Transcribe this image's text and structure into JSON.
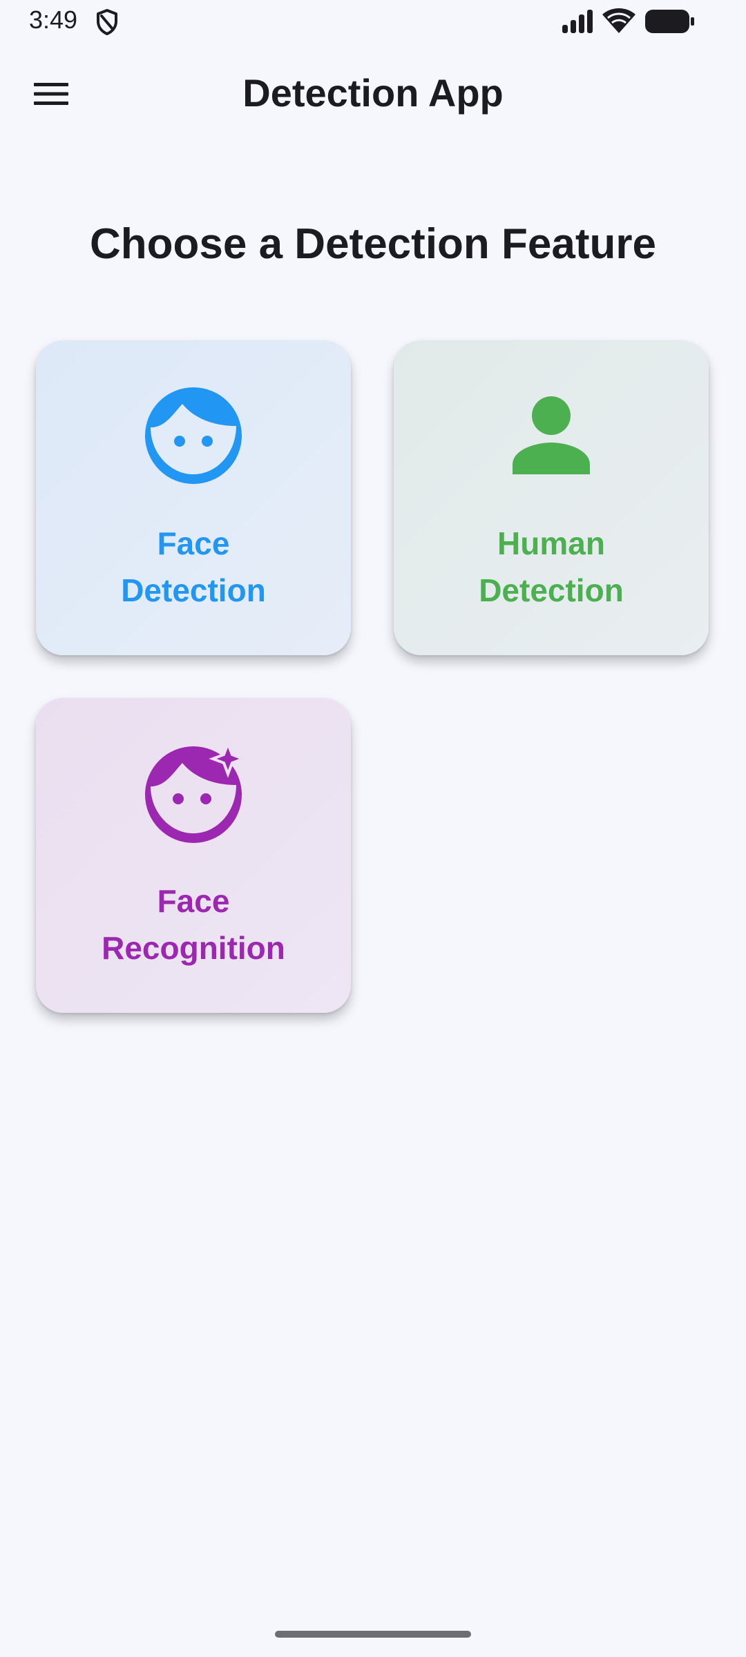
{
  "status_bar": {
    "time": "3:49",
    "icons": [
      "shield-icon",
      "signal-icon",
      "wifi-icon",
      "battery-icon"
    ]
  },
  "app_bar": {
    "title": "Detection App",
    "menu_icon": "menu-icon"
  },
  "main": {
    "heading": "Choose a Detection Feature",
    "features": [
      {
        "line1": "Face",
        "line2": "Detection",
        "icon": "face-icon",
        "color": "#2196f3"
      },
      {
        "line1": "Human",
        "line2": "Detection",
        "icon": "person-icon",
        "color": "#4caf50"
      },
      {
        "line1": "Face",
        "line2": "Recognition",
        "icon": "face-retouching-icon",
        "color": "#9c27b0"
      }
    ]
  },
  "colors": {
    "background": "#f6f7fd",
    "text": "#1c1b1f"
  }
}
